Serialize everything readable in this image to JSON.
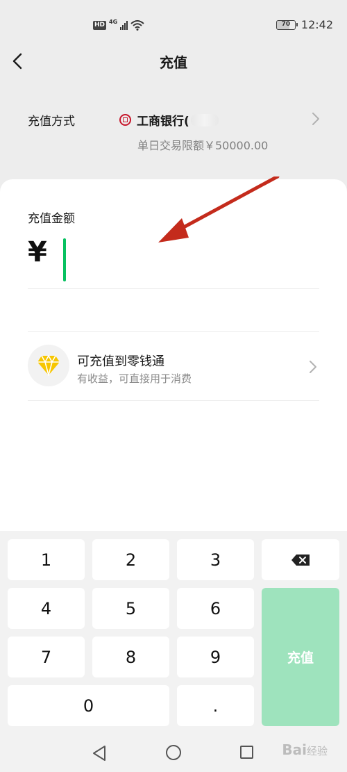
{
  "status_bar": {
    "hd": "HD",
    "network": "4G",
    "battery": "70",
    "time": "12:42"
  },
  "header": {
    "title": "充值"
  },
  "payment_method": {
    "label": "充值方式",
    "bank_name": "工商银行(",
    "daily_limit": "单日交易限额￥50000.00"
  },
  "amount": {
    "label": "充值金额",
    "currency_symbol": "¥",
    "value": "",
    "accent_color": "#07c160"
  },
  "lingqiantong": {
    "title": "可充值到零钱通",
    "subtitle": "有收益，可直接用于消费",
    "icon": "diamond-icon"
  },
  "keypad": {
    "keys": [
      "1",
      "2",
      "3",
      "4",
      "5",
      "6",
      "7",
      "8",
      "9",
      "0",
      "."
    ],
    "delete_icon": "backspace-icon",
    "submit_label": "充值",
    "submit_color": "#9ee3bd"
  },
  "watermark": {
    "text": "Bai",
    "suffix": "经验"
  }
}
